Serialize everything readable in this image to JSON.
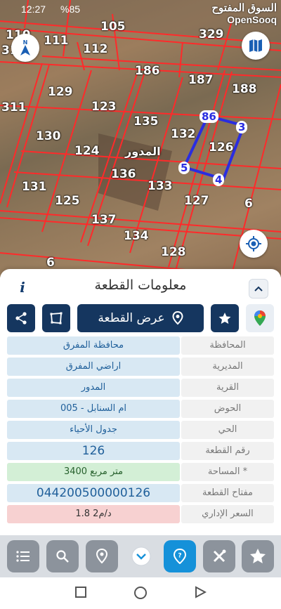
{
  "status": {
    "time": "12:27",
    "battery": "%85"
  },
  "brand": {
    "arabic": "السوق المفتوح",
    "english": "OpenSooq"
  },
  "map": {
    "area_name": "المدور",
    "parcels": [
      "105",
      "111",
      "112",
      "329",
      "311",
      "186",
      "187",
      "188",
      "129",
      "123",
      "135",
      "132",
      "126",
      "130",
      "124",
      "136",
      "133",
      "131",
      "125",
      "127",
      "137",
      "134",
      "128",
      "6",
      "6"
    ],
    "partial_labels": [
      "110",
      "31"
    ],
    "vertices": [
      "86",
      "3",
      "5",
      "4"
    ]
  },
  "panel": {
    "title": "معلومات القطعة",
    "show_parcel_label": "عرض القطعة",
    "rows": [
      {
        "label": "المحافظة",
        "value": "محافظة المفرق"
      },
      {
        "label": "المديرية",
        "value": "اراضي المفرق"
      },
      {
        "label": "القرية",
        "value": "المدور"
      },
      {
        "label": "الحوض",
        "value": "ام السنابل - 005"
      },
      {
        "label": "الحي",
        "value": "جدول الأحياء"
      },
      {
        "label": "رقم القطعة",
        "value": "126"
      },
      {
        "label": "المساحة *",
        "value": "3400  متر مربع"
      },
      {
        "label": "مفتاح القطعة",
        "value": "044200500000126"
      },
      {
        "label": "السعر الإداري",
        "value": "1.8 د/م2"
      }
    ]
  },
  "colors": {
    "primary": "#15365f",
    "accent": "#1591d9",
    "parcel_line": "#ff2020",
    "selection": "#2a2de0"
  }
}
